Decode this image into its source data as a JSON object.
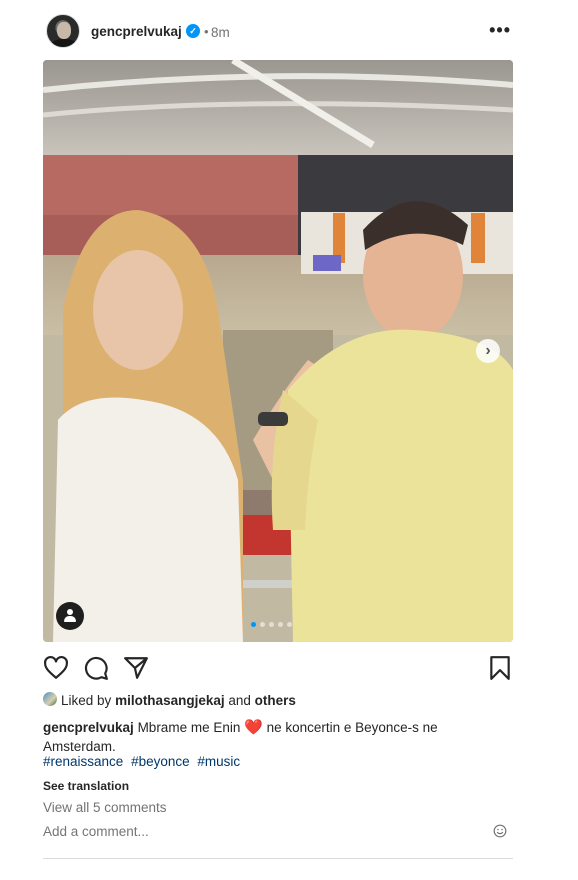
{
  "post": {
    "username": "gencprelvukaj",
    "separator": "•",
    "time": "8m",
    "verified_mark": "✓",
    "more_label": "•••",
    "next_arrow": "›",
    "carousel_dots": 5,
    "carousel_active": 1
  },
  "actions": {
    "like_icon": "heart-outline-icon",
    "comment_icon": "comment-bubble-icon",
    "share_icon": "paper-plane-icon",
    "save_icon": "bookmark-icon"
  },
  "likes": {
    "prefix": "Liked by",
    "user": "milothasangjekaj",
    "and": "and",
    "others": "others"
  },
  "caption": {
    "username": "gencprelvukaj",
    "text_before": "Mbrame me Enin",
    "emoji": "❤️",
    "text_after": "ne koncertin e Beyonce-s ne Amsterdam.",
    "hashtags": [
      "#renaissance",
      "#beyonce",
      "#music"
    ]
  },
  "see_translation": "See translation",
  "view_comments": "View all 5 comments",
  "comment_input": {
    "placeholder": "Add a comment..."
  },
  "colors": {
    "link": "#00376b",
    "verified": "#0095f6",
    "muted": "#737373"
  }
}
